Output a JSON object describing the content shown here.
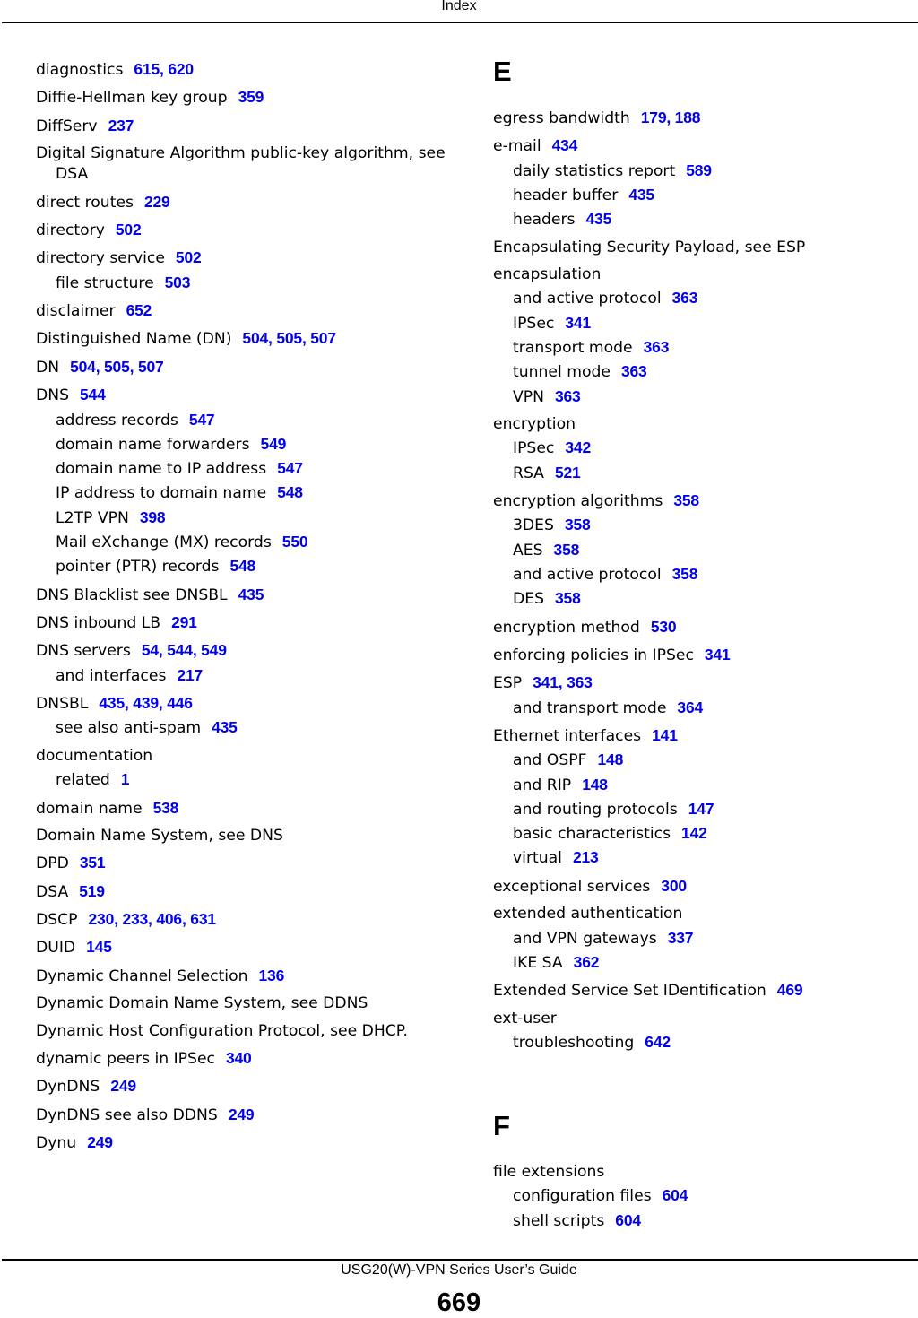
{
  "header": {
    "title": "Index"
  },
  "footer": {
    "guide_title": "USG20(W)-VPN Series User’s Guide",
    "page_number": "669"
  },
  "left_column": [
    {
      "term": "diagnostics",
      "pages": "615, 620",
      "subs": []
    },
    {
      "term": "Diffie-Hellman key group",
      "pages": "359",
      "subs": []
    },
    {
      "term": "DiffServ",
      "pages": "237",
      "subs": []
    },
    {
      "term": "Digital Signature Algorithm public-key algorithm, see DSA",
      "pages": "",
      "subs": []
    },
    {
      "term": "direct routes",
      "pages": "229",
      "subs": []
    },
    {
      "term": "directory",
      "pages": "502",
      "subs": []
    },
    {
      "term": "directory service",
      "pages": "502",
      "subs": [
        {
          "term": "file structure",
          "pages": "503"
        }
      ]
    },
    {
      "term": "disclaimer",
      "pages": "652",
      "subs": []
    },
    {
      "term": "Distinguished Name (DN)",
      "pages": "504, 505, 507",
      "subs": []
    },
    {
      "term": "DN",
      "pages": "504, 505, 507",
      "subs": []
    },
    {
      "term": "DNS",
      "pages": "544",
      "subs": [
        {
          "term": "address records",
          "pages": "547"
        },
        {
          "term": "domain name forwarders",
          "pages": "549"
        },
        {
          "term": "domain name to IP address",
          "pages": "547"
        },
        {
          "term": "IP address to domain name",
          "pages": "548"
        },
        {
          "term": "L2TP VPN",
          "pages": "398"
        },
        {
          "term": "Mail eXchange (MX) records",
          "pages": "550"
        },
        {
          "term": "pointer (PTR) records",
          "pages": "548"
        }
      ]
    },
    {
      "term": "DNS Blacklist see DNSBL",
      "pages": "435",
      "subs": []
    },
    {
      "term": "DNS inbound LB",
      "pages": "291",
      "subs": []
    },
    {
      "term": "DNS servers",
      "pages": "54, 544, 549",
      "subs": [
        {
          "term": "and interfaces",
          "pages": "217"
        }
      ]
    },
    {
      "term": "DNSBL",
      "pages": "435, 439, 446",
      "subs": [
        {
          "term": "see also anti-spam",
          "pages": "435"
        }
      ]
    },
    {
      "term": "documentation",
      "pages": "",
      "subs": [
        {
          "term": "related",
          "pages": "1"
        }
      ]
    },
    {
      "term": "domain name",
      "pages": "538",
      "subs": []
    },
    {
      "term": "Domain Name System, see DNS",
      "pages": "",
      "subs": []
    },
    {
      "term": "DPD",
      "pages": "351",
      "subs": []
    },
    {
      "term": "DSA",
      "pages": "519",
      "subs": []
    },
    {
      "term": "DSCP",
      "pages": "230, 233, 406, 631",
      "subs": []
    },
    {
      "term": "DUID",
      "pages": "145",
      "subs": []
    },
    {
      "term": "Dynamic Channel Selection",
      "pages": "136",
      "subs": []
    },
    {
      "term": "Dynamic Domain Name System, see DDNS",
      "pages": "",
      "subs": []
    },
    {
      "term": "Dynamic Host Configuration Protocol, see DHCP.",
      "pages": "",
      "subs": []
    },
    {
      "term": "dynamic peers in IPSec",
      "pages": "340",
      "subs": []
    },
    {
      "term": "DynDNS",
      "pages": "249",
      "subs": []
    },
    {
      "term": "DynDNS see also DDNS",
      "pages": "249",
      "subs": []
    },
    {
      "term": "Dynu",
      "pages": "249",
      "subs": []
    }
  ],
  "right_column": {
    "section_e": {
      "letter": "E",
      "entries": [
        {
          "term": "egress bandwidth",
          "pages": "179, 188",
          "subs": []
        },
        {
          "term": "e-mail",
          "pages": "434",
          "subs": [
            {
              "term": "daily statistics report",
              "pages": "589"
            },
            {
              "term": "header buffer",
              "pages": "435"
            },
            {
              "term": "headers",
              "pages": "435"
            }
          ]
        },
        {
          "term": "Encapsulating Security Payload, see ESP",
          "pages": "",
          "subs": []
        },
        {
          "term": "encapsulation",
          "pages": "",
          "subs": [
            {
              "term": "and active protocol",
              "pages": "363"
            },
            {
              "term": "IPSec",
              "pages": "341"
            },
            {
              "term": "transport mode",
              "pages": "363"
            },
            {
              "term": "tunnel mode",
              "pages": "363"
            },
            {
              "term": "VPN",
              "pages": "363"
            }
          ]
        },
        {
          "term": "encryption",
          "pages": "",
          "subs": [
            {
              "term": "IPSec",
              "pages": "342"
            },
            {
              "term": "RSA",
              "pages": "521"
            }
          ]
        },
        {
          "term": "encryption algorithms",
          "pages": "358",
          "subs": [
            {
              "term": "3DES",
              "pages": "358"
            },
            {
              "term": "AES",
              "pages": "358"
            },
            {
              "term": "and active protocol",
              "pages": "358"
            },
            {
              "term": "DES",
              "pages": "358"
            }
          ]
        },
        {
          "term": "encryption method",
          "pages": "530",
          "subs": []
        },
        {
          "term": "enforcing policies in IPSec",
          "pages": "341",
          "subs": []
        },
        {
          "term": "ESP",
          "pages": "341, 363",
          "subs": [
            {
              "term": "and transport mode",
              "pages": "364"
            }
          ]
        },
        {
          "term": "Ethernet interfaces",
          "pages": "141",
          "subs": [
            {
              "term": "and OSPF",
              "pages": "148"
            },
            {
              "term": "and RIP",
              "pages": "148"
            },
            {
              "term": "and routing protocols",
              "pages": "147"
            },
            {
              "term": "basic characteristics",
              "pages": "142"
            },
            {
              "term": "virtual",
              "pages": "213"
            }
          ]
        },
        {
          "term": "exceptional services",
          "pages": "300",
          "subs": []
        },
        {
          "term": "extended authentication",
          "pages": "",
          "subs": [
            {
              "term": "and VPN gateways",
              "pages": "337"
            },
            {
              "term": "IKE SA",
              "pages": "362"
            }
          ]
        },
        {
          "term": "Extended Service Set IDentification",
          "pages": "469",
          "subs": []
        },
        {
          "term": "ext-user",
          "pages": "",
          "subs": [
            {
              "term": "troubleshooting",
              "pages": "642"
            }
          ]
        }
      ]
    },
    "section_f": {
      "letter": "F",
      "entries": [
        {
          "term": "file extensions",
          "pages": "",
          "subs": [
            {
              "term": "configuration files",
              "pages": "604"
            },
            {
              "term": "shell scripts",
              "pages": "604"
            }
          ]
        }
      ]
    }
  },
  "colors": {
    "page_link": "#0000ee",
    "text": "#000000"
  }
}
